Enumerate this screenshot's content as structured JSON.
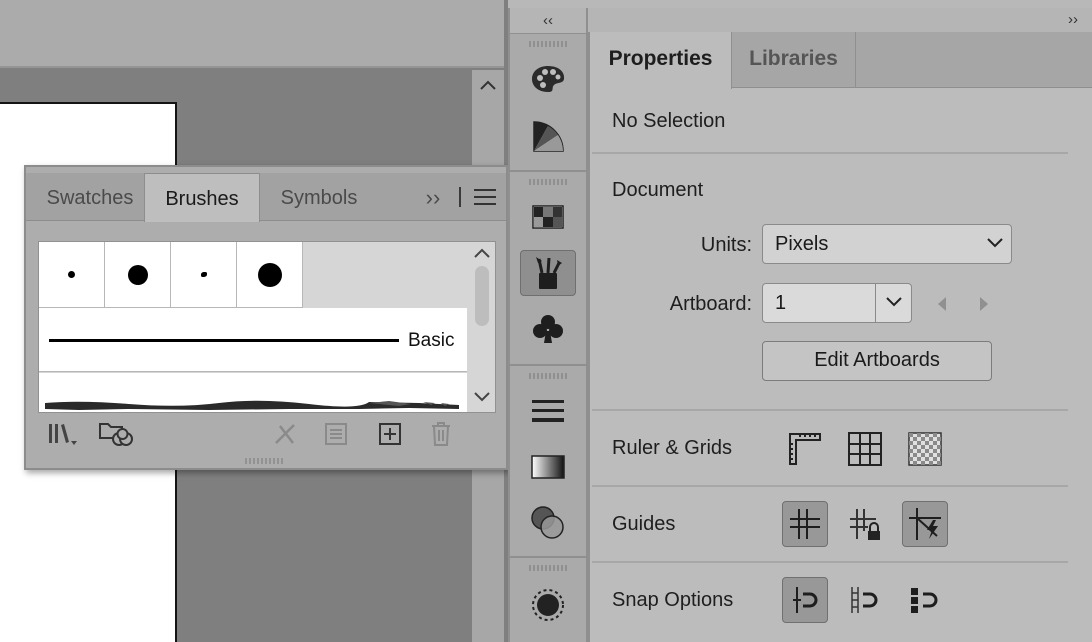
{
  "dock": {
    "collapse_left": "‹‹",
    "items": [
      {
        "icon": "color-palette-icon"
      },
      {
        "icon": "color-guide-icon"
      },
      {
        "icon": "swatches-icon"
      },
      {
        "icon": "brushes-icon",
        "selected": true
      },
      {
        "icon": "symbols-icon"
      },
      {
        "icon": "stroke-icon"
      },
      {
        "icon": "gradient-icon"
      },
      {
        "icon": "transparency-icon"
      },
      {
        "icon": "appearance-icon"
      }
    ]
  },
  "brushes_panel": {
    "tabs": [
      "Swatches",
      "Brushes",
      "Symbols"
    ],
    "active_tab": "Brushes",
    "expand_label": "››",
    "brushes": [
      {
        "type": "calligraphic"
      },
      {
        "type": "round"
      },
      {
        "type": "calligraphic"
      },
      {
        "type": "round"
      },
      {
        "type": "basic",
        "label": "Basic"
      },
      {
        "type": "charcoal"
      }
    ],
    "footer_icons": [
      "brush-libraries-icon",
      "libraries-panel-icon",
      "remove-stroke-icon",
      "brush-options-icon",
      "new-brush-icon",
      "delete-brush-icon"
    ]
  },
  "properties": {
    "expand_right": "››",
    "tabs": [
      "Properties",
      "Libraries"
    ],
    "active_tab": "Properties",
    "selection_status": "No Selection",
    "document_heading": "Document",
    "units_label": "Units:",
    "units_value": "Pixels",
    "artboard_label": "Artboard:",
    "artboard_value": "1",
    "edit_artboards": "Edit Artboards",
    "ruler_grids_heading": "Ruler & Grids",
    "guides_heading": "Guides",
    "snap_heading": "Snap Options"
  }
}
